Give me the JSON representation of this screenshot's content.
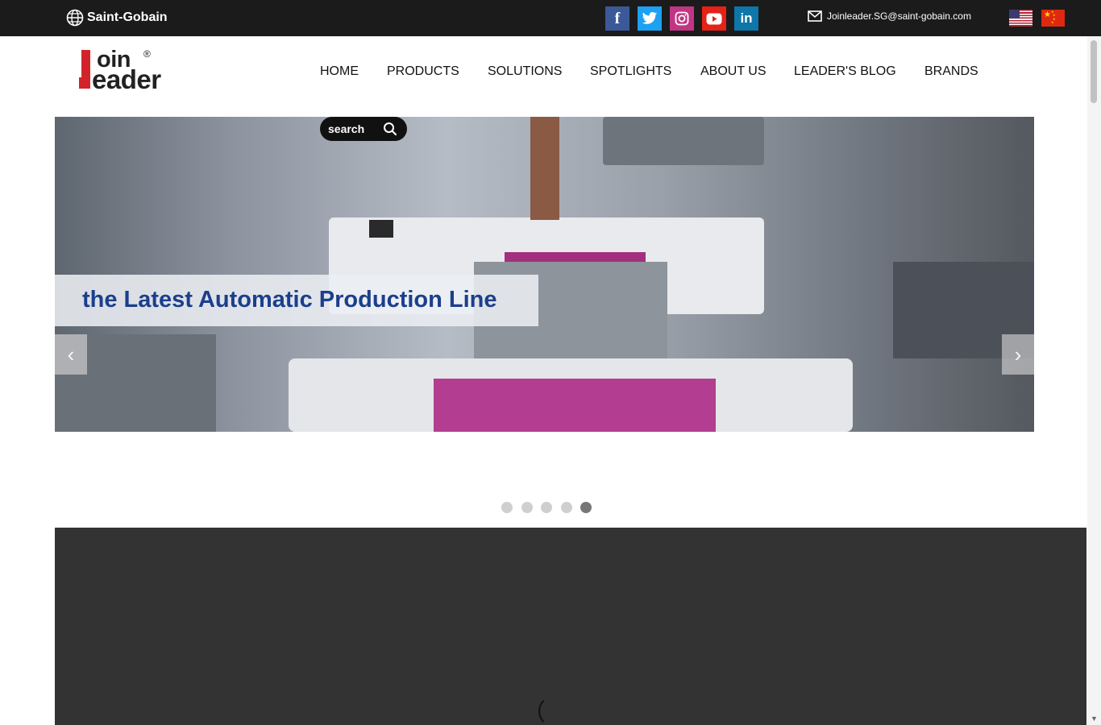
{
  "topbar": {
    "brand": "Saint-Gobain",
    "email": "Joinleader.SG@saint-gobain.com",
    "social": [
      "facebook-icon",
      "twitter-icon",
      "instagram-icon",
      "youtube-icon",
      "linkedin-icon"
    ],
    "languages": [
      "English (US)",
      "Chinese"
    ]
  },
  "logo": {
    "line1": "oin",
    "line2": "eader",
    "reg": "®"
  },
  "nav": {
    "items": [
      "HOME",
      "PRODUCTS",
      "SOLUTIONS",
      "SPOTLIGHTS",
      "ABOUT US",
      "LEADER'S BLOG",
      "BRANDS"
    ]
  },
  "search": {
    "label": "search"
  },
  "banner": {
    "caption": "the Latest Automatic Production Line",
    "slide_count": 5,
    "active_slide": 5
  },
  "colors": {
    "topbar": "#1b1b1b",
    "logo_red": "#d2232a",
    "caption_blue": "#1b3f8c",
    "dark_section": "#333333"
  }
}
